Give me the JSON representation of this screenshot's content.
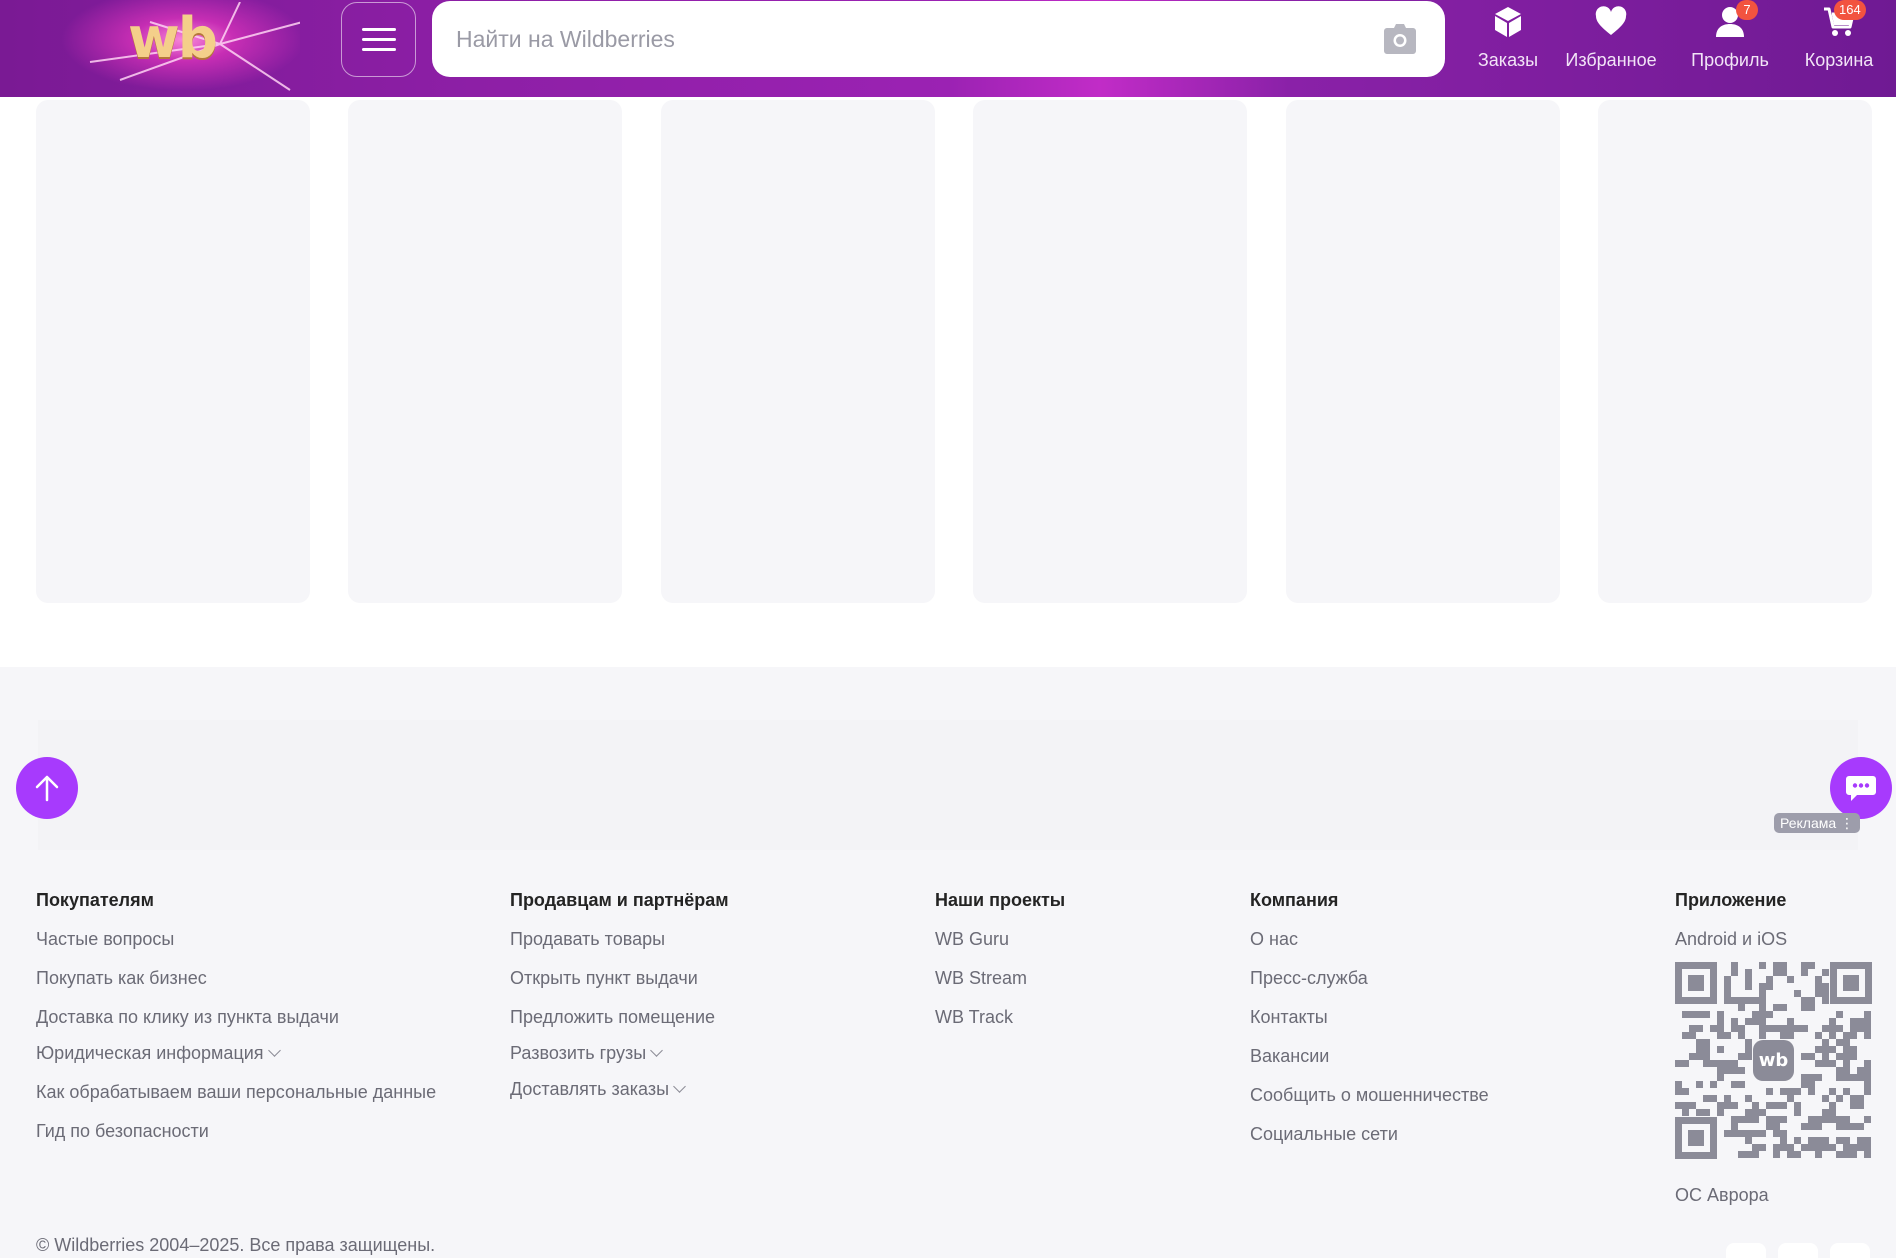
{
  "header": {
    "logo": "wb",
    "search_placeholder": "Найти на Wildberries",
    "nav": [
      {
        "label": "Заказы",
        "icon": "box-icon"
      },
      {
        "label": "Избранное",
        "icon": "heart-icon"
      },
      {
        "label": "Профиль",
        "icon": "user-icon",
        "badge": "7"
      },
      {
        "label": "Корзина",
        "icon": "cart-icon",
        "badge": "164"
      }
    ]
  },
  "ad": {
    "label": "Реклама ⋮"
  },
  "footer": {
    "buyers": {
      "title": "Покупателям",
      "links": [
        "Частые вопросы",
        "Покупать как бизнес",
        "Доставка по клику из пункта выдачи",
        "Юридическая информация",
        "Как обрабатываем ваши персональные данные",
        "Гид по безопасности"
      ]
    },
    "sellers": {
      "title": "Продавцам и партнёрам",
      "links": [
        "Продавать товары",
        "Открыть пункт выдачи",
        "Предложить помещение",
        "Развозить грузы",
        "Доставлять заказы"
      ]
    },
    "projects": {
      "title": "Наши проекты",
      "links": [
        "WB Guru",
        "WB Stream",
        "WB Track"
      ]
    },
    "company": {
      "title": "Компания",
      "links": [
        "О нас",
        "Пресс-служба",
        "Контакты",
        "Вакансии",
        "Сообщить о мошенничестве",
        "Социальные сети"
      ]
    },
    "app": {
      "title": "Приложение",
      "platforms": "Android и iOS",
      "qr_logo": "wb",
      "aurora": "ОС Аврора"
    },
    "copyright": "© Wildberries 2004–2025. Все права защищены."
  },
  "colors": {
    "accent": "#a73afd",
    "header_purple": "#8d1fa6",
    "badge": "#f2533f",
    "skeleton": "#f6f6f9"
  }
}
